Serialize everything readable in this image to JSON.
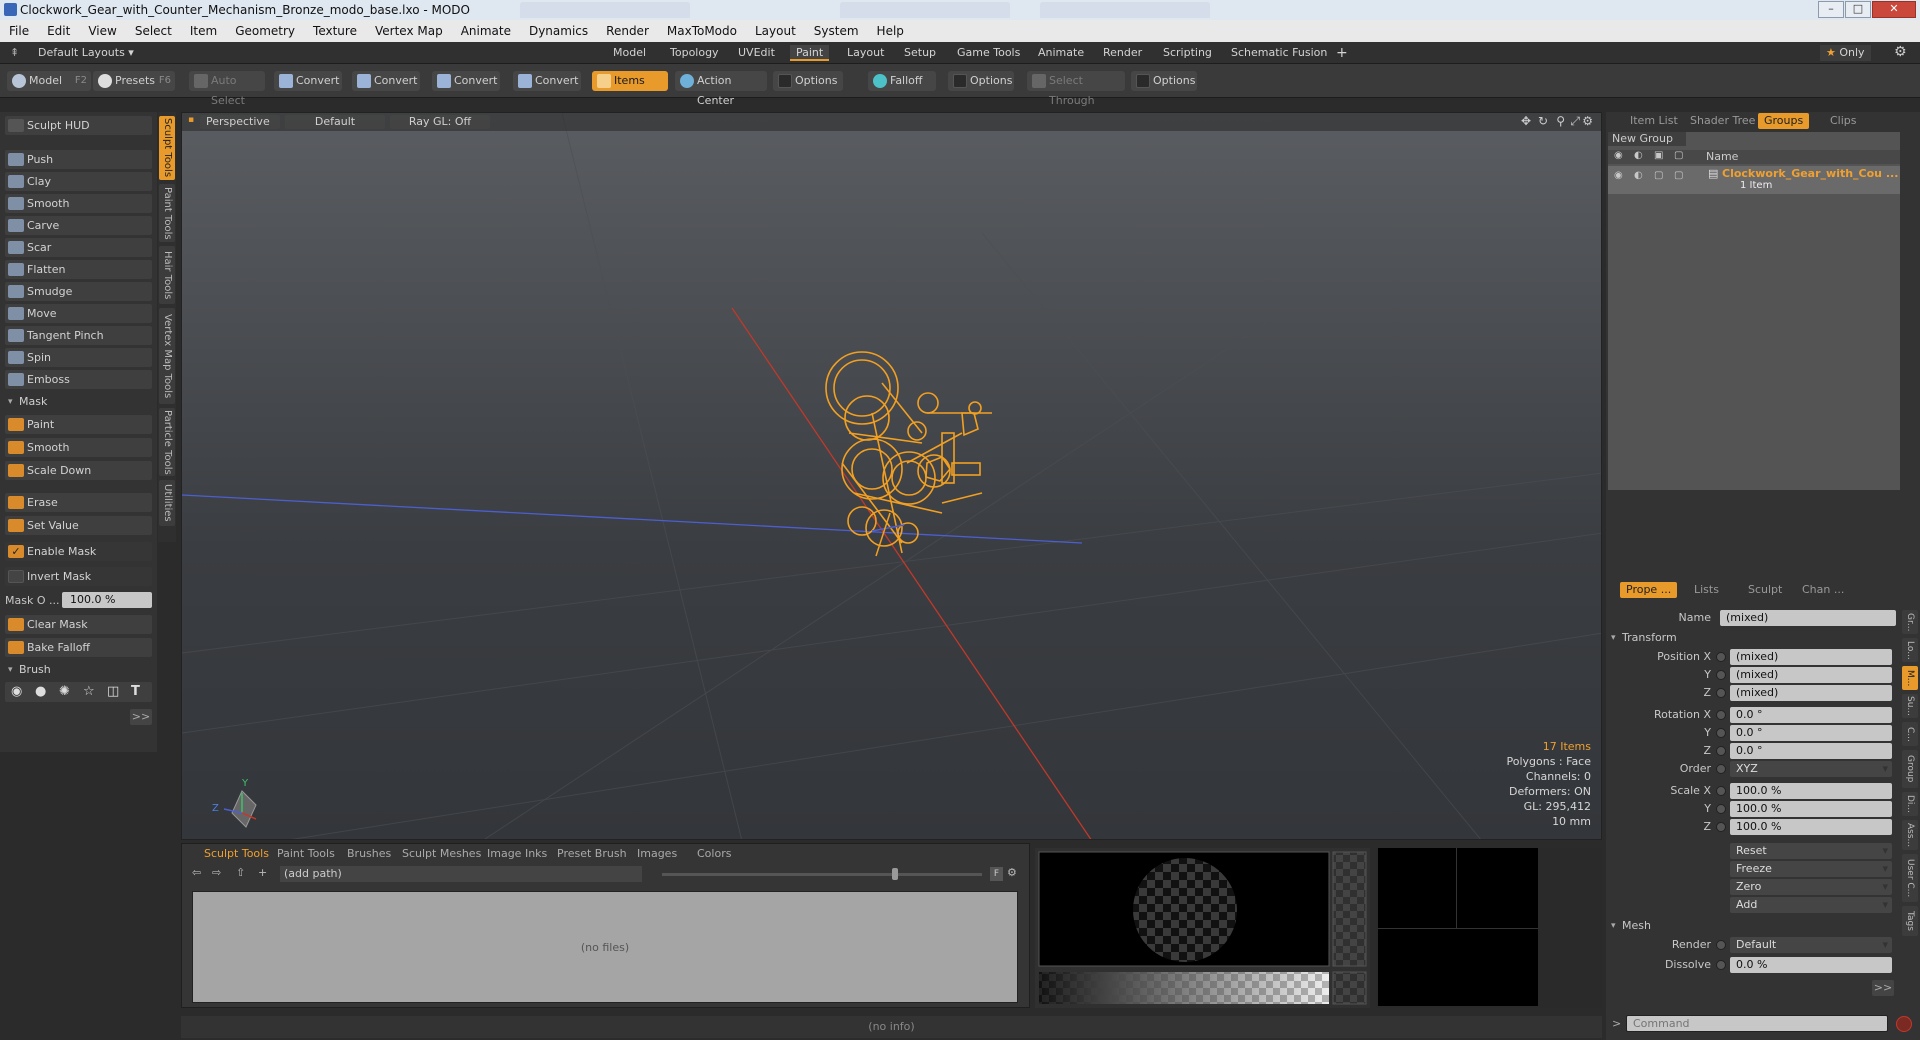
{
  "window": {
    "title": "Clockwork_Gear_with_Counter_Mechanism_Bronze_modo_base.lxo - MODO",
    "minimize": "–",
    "maximize": "□",
    "close": "✕"
  },
  "menu": [
    "File",
    "Edit",
    "View",
    "Select",
    "Item",
    "Geometry",
    "Texture",
    "Vertex Map",
    "Animate",
    "Dynamics",
    "Render",
    "MaxToModo",
    "Layout",
    "System",
    "Help"
  ],
  "layouts": {
    "dropdown": "Default Layouts ▾",
    "tabs": [
      "Model",
      "Topology",
      "UVEdit",
      "Paint",
      "Layout",
      "Setup",
      "Game Tools",
      "Animate",
      "Render",
      "Scripting",
      "Schematic Fusion"
    ],
    "active": "Paint",
    "add": "+",
    "only": "Only"
  },
  "toolbar": {
    "model": "Model",
    "model_key": "F2",
    "presets": "Presets",
    "presets_key": "F6",
    "auto_select": "Auto Select",
    "convert": "Convert",
    "items": "Items",
    "action_center": "Action Center",
    "options": "Options",
    "falloff": "Falloff",
    "select_through": "Select Through"
  },
  "left": {
    "hud": "Sculpt HUD",
    "tools": [
      "Push",
      "Clay",
      "Smooth",
      "Carve",
      "Scar",
      "Flatten",
      "Smudge",
      "Move",
      "Tangent Pinch",
      "Spin",
      "Emboss"
    ],
    "mask_header": "Mask",
    "mask_tools": [
      "Paint",
      "Smooth",
      "Scale Down"
    ],
    "erase": "Erase",
    "set_value": "Set Value",
    "enable_mask": "Enable Mask",
    "invert_mask": "Invert Mask",
    "mask_opacity_label": "Mask O ...",
    "mask_opacity_value": "100.0 %",
    "clear_mask": "Clear Mask",
    "bake_falloff": "Bake Falloff",
    "brush_header": "Brush",
    "more": ">>",
    "vtabs": [
      "Sculpt Tools",
      "Paint Tools",
      "Hair Tools",
      "Vertex Map Tools",
      "Particle Tools",
      "Utilities"
    ]
  },
  "viewport": {
    "projection": "Perspective",
    "shading": "Default",
    "raygl": "Ray GL: Off",
    "info": {
      "items": "17 Items",
      "polygons": "Polygons : Face",
      "channels": "Channels: 0",
      "deformers": "Deformers: ON",
      "gl": "GL: 295,412",
      "unit": "10 mm"
    },
    "axis_y": "Y",
    "axis_z": "Z"
  },
  "browser": {
    "tabs": [
      "Sculpt Tools",
      "Paint Tools",
      "Brushes",
      "Sculpt Meshes",
      "Image Inks",
      "Preset Brush",
      "Images",
      "Colors"
    ],
    "path": "(add path)",
    "no_files": "(no files)",
    "f_btn": "F"
  },
  "status": "(no info)",
  "right": {
    "tabs_top": [
      "Item List",
      "Shader Tree",
      "Groups",
      "Clips"
    ],
    "active_top": "Groups",
    "new_group": "New Group",
    "name_col": "Name",
    "group_name": "Clockwork_Gear_with_Cou ...",
    "group_count": "1 Item",
    "tabs_props": [
      "Prope ...",
      "Lists",
      "Sculpt",
      "Chan ..."
    ],
    "props": {
      "name_label": "Name",
      "name_value": "(mixed)",
      "transform": "Transform",
      "position_x": "Position X",
      "y": "Y",
      "z": "Z",
      "mixed": "(mixed)",
      "rotation_x": "Rotation X",
      "rot_val": "0.0 °",
      "order_label": "Order",
      "order_value": "XYZ",
      "scale_x": "Scale X",
      "scale_val": "100.0 %",
      "reset": "Reset",
      "freeze": "Freeze",
      "zero": "Zero",
      "add": "Add",
      "mesh": "Mesh",
      "render_label": "Render",
      "render_value": "Default",
      "dissolve_label": "Dissolve",
      "dissolve_value": "0.0 %",
      "more": ">>"
    },
    "vtabs": [
      "Gr...",
      "Lo...",
      "M...",
      "Su...",
      "C...",
      "Group",
      "Di...",
      "Ass...",
      "User C...",
      "Tags"
    ],
    "command_placeholder": "Command",
    "prompt": ">"
  }
}
